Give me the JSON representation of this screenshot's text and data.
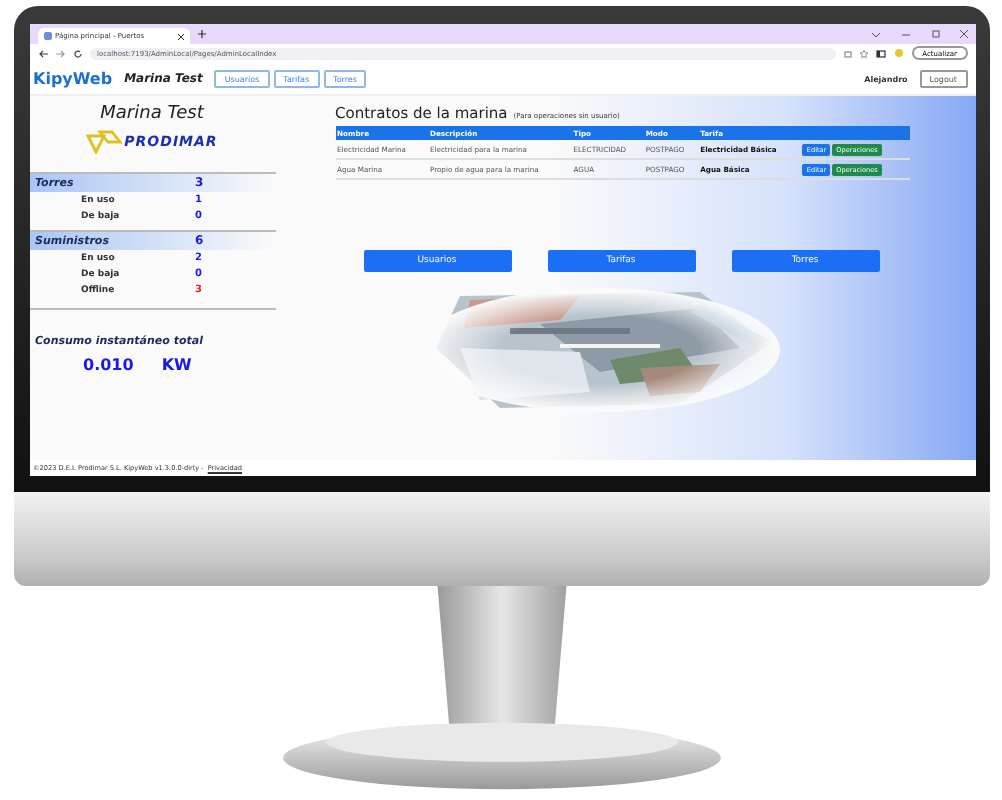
{
  "browser": {
    "tab_title": "Página principal - Puertos",
    "url": "localhost:7193/AdminLocal/Pages/AdminLocalIndex",
    "update_button": "Actualizar"
  },
  "header": {
    "brand": "KipyWeb",
    "site": "Marina Test",
    "nav": [
      "Usuarios",
      "Tarifas",
      "Torres"
    ],
    "user": "Alejandro",
    "logout": "Logout"
  },
  "sidebar": {
    "title": "Marina Test",
    "logo": "PRODIMAR",
    "sections": [
      {
        "title": "Torres",
        "total": "3",
        "rows": [
          {
            "label": "En uso",
            "value": "1",
            "color": "#1a1ae6"
          },
          {
            "label": "De baja",
            "value": "0",
            "color": "#1a1ae6"
          }
        ]
      },
      {
        "title": "Suministros",
        "total": "6",
        "rows": [
          {
            "label": "En uso",
            "value": "2",
            "color": "#1a1ae6"
          },
          {
            "label": "De baja",
            "value": "0",
            "color": "#1a1ae6"
          },
          {
            "label": "Offline",
            "value": "3",
            "color": "#e62020"
          }
        ]
      }
    ],
    "consumption": {
      "title": "Consumo instantáneo total",
      "value": "0.010",
      "unit": "KW"
    }
  },
  "contracts": {
    "title": "Contratos de la marina",
    "note": "(Para operaciones sin usuario)",
    "columns": [
      "Nombre",
      "Descripción",
      "Tipo",
      "Modo",
      "Tarifa"
    ],
    "rows": [
      {
        "cells": [
          "Electricidad Marina",
          "Electricidad para la marina",
          "ELECTRICIDAD",
          "POSTPAGO",
          "Electricidad Básica"
        ],
        "actions": [
          "Editar",
          "Operaciones"
        ]
      },
      {
        "cells": [
          "Agua Marina",
          "Propio de agua para la marina",
          "AGUA",
          "POSTPAGO",
          "Agua Básica"
        ],
        "actions": [
          "Editar",
          "Operaciones"
        ]
      }
    ]
  },
  "buttons": [
    "Usuarios",
    "Tarifas",
    "Torres"
  ],
  "footer": {
    "text": "©2023 D.E.I. Prodimar S.L. KipyWeb v1.3.0.0-dirty -",
    "link": "Privacidad"
  }
}
